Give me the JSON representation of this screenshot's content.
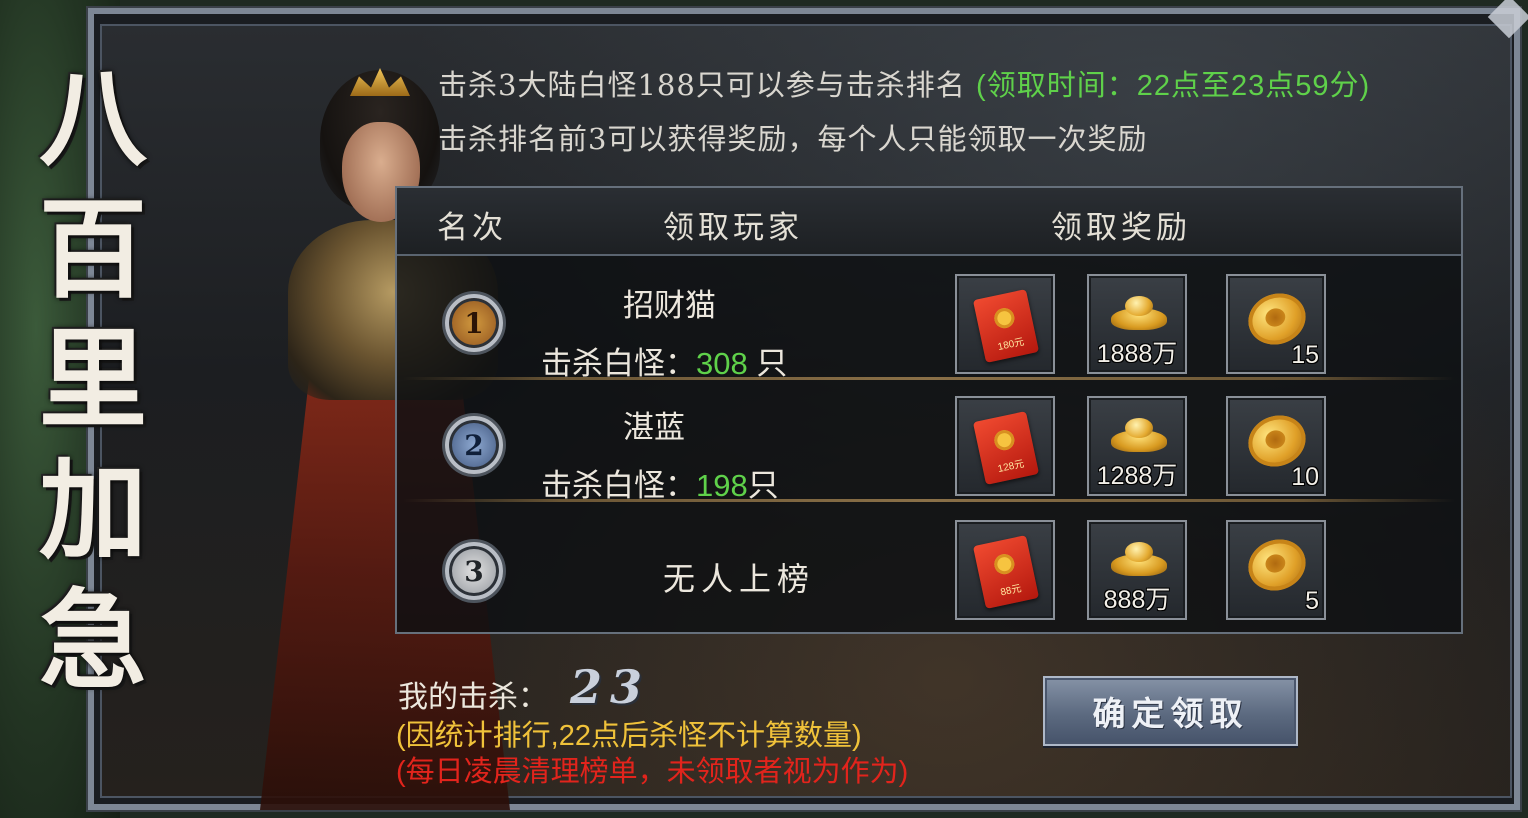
{
  "banner": {
    "title_chars": [
      "八",
      "百",
      "里",
      "加",
      "急"
    ]
  },
  "rules": {
    "line1_main": "击杀3大陆白怪188只可以参与击杀排名",
    "line1_time": "(领取时间：22点至23点59分)",
    "line2": "击杀排名前3可以获得奖励，每个人只能领取一次奖励"
  },
  "table": {
    "headers": {
      "rank": "名次",
      "player": "领取玩家",
      "reward": "领取奖励"
    },
    "kill_prefix": "击杀白怪：",
    "rows": [
      {
        "rank": "1",
        "player": "招财猫",
        "kills": "308",
        "kills_unit": " 只",
        "rewards": [
          {
            "icon": "red-envelope-icon",
            "label": "180元",
            "qty": ""
          },
          {
            "icon": "gold-ingot-icon",
            "label": "",
            "qty": "1888万"
          },
          {
            "icon": "gold-coin-icon",
            "label": "",
            "qty": "15"
          }
        ]
      },
      {
        "rank": "2",
        "player": "湛蓝",
        "kills": "198",
        "kills_unit": "只",
        "rewards": [
          {
            "icon": "red-envelope-icon",
            "label": "128元",
            "qty": ""
          },
          {
            "icon": "gold-ingot-icon",
            "label": "",
            "qty": "1288万"
          },
          {
            "icon": "gold-coin-icon",
            "label": "",
            "qty": "10"
          }
        ]
      },
      {
        "rank": "3",
        "player": "无人上榜",
        "kills": "",
        "kills_unit": "",
        "rewards": [
          {
            "icon": "red-envelope-icon",
            "label": "88元",
            "qty": ""
          },
          {
            "icon": "gold-ingot-icon",
            "label": "",
            "qty": "888万"
          },
          {
            "icon": "gold-coin-icon",
            "label": "",
            "qty": "5"
          }
        ]
      }
    ]
  },
  "footer": {
    "my_kills_label": "我的击杀：",
    "my_kills_value": "23",
    "note_yellow": "(因统计排行,22点后杀怪不计算数量)",
    "note_red": "(每日凌晨清理榜单，未领取者视为作为)",
    "confirm_button": "确定领取"
  },
  "colors": {
    "green_text": "#5fd14a",
    "yellow_note": "#f0c23a",
    "red_note": "#e2241c",
    "button": "#5c6a80"
  }
}
